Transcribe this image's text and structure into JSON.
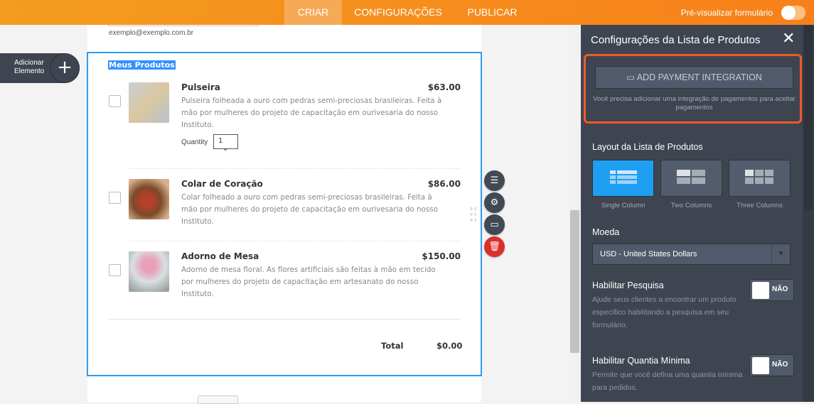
{
  "topbar": {
    "tabs": [
      "CRIAR",
      "CONFIGURAÇÕES",
      "PUBLICAR"
    ],
    "preview_label": "Pré-visualizar formulário"
  },
  "form": {
    "email_hint": "exemplo@exemplo.com.br",
    "add_element": "Adicionar Elemento",
    "title": "Meus Produtos",
    "products": [
      {
        "name": "Pulseira",
        "price": "$63.00",
        "desc": "Pulseira folheada a ouro com pedras semi-preciosas brasileiras. Feita à mão por mulheres do projeto de capacitação em ourivesaria do nosso Instituto.",
        "quantity_label": "Quantity",
        "quantity": "1"
      },
      {
        "name": "Colar de Coração",
        "price": "$86.00",
        "desc": "Colar folheado a ouro com pedras semi-preciosas brasileiras. Feita à mão por mulheres do projeto de capacitação em ourivesaria do nosso Instituto."
      },
      {
        "name": "Adorno de Mesa",
        "price": "$150.00",
        "desc": "Adorno de mesa floral. As flores artificiais são feitas à mão em tecido por mulheres do projeto de capacitação em artesanato do nosso Instituto."
      }
    ],
    "total_label": "Total",
    "total": "$0.00"
  },
  "panel": {
    "title": "Configurações da Lista de Produtos",
    "pay_button": "ADD PAYMENT INTEGRATION",
    "pay_note": "Você precisa adicionar uma integração de pagamentos para aceitar pagamentos",
    "layout_title": "Layout da Lista de Produtos",
    "layouts": [
      "Single Column",
      "Two Columns",
      "Three Columns"
    ],
    "selected_layout": "Single Column",
    "currency_label": "Moeda",
    "currency": "USD - United States Dollars",
    "search_title": "Habilitar Pesquisa",
    "search_desc": "Ajude seus clientes a encontrar um produto específico habilitando a pesquisa em seu formulário.",
    "search_value": "NÃO",
    "minqty_title": "Habilitar Quantia Mínima",
    "minqty_desc": "Permite que você defina uma quantia mínima para pedidos.",
    "minqty_value": "NÃO"
  },
  "colors": {
    "accent": "#f7821b",
    "selection": "#2d9cf0",
    "highlight": "#f05a28"
  }
}
